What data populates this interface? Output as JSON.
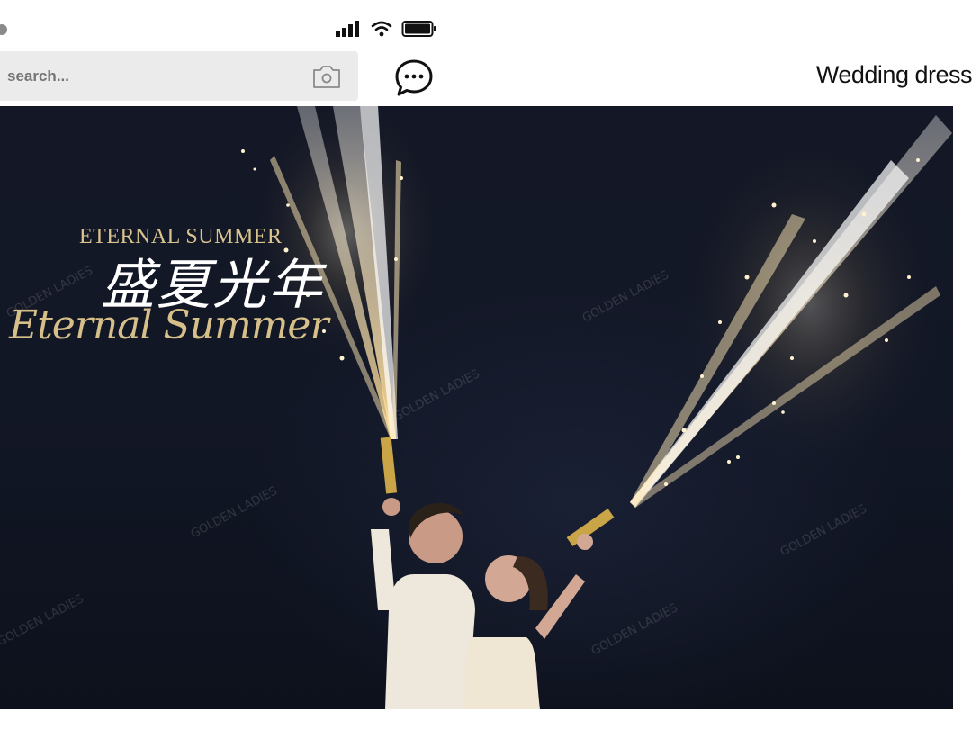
{
  "status_bar": {
    "signal_icon": "cellular-signal-icon",
    "wifi_icon": "wifi-icon",
    "battery_icon": "battery-icon"
  },
  "search": {
    "placeholder": "search...",
    "camera_icon": "camera-icon"
  },
  "chat_icon": "chat-bubble-icon",
  "header": {
    "title": "Wedding dress"
  },
  "photo": {
    "brand_en": "ETERNAL SUMMER",
    "brand_cn": "盛夏光年",
    "brand_script": "Eternal Summer",
    "colors": {
      "sky": "#121726",
      "gold": "#d9c38f",
      "spark": "#fff4d6"
    }
  }
}
